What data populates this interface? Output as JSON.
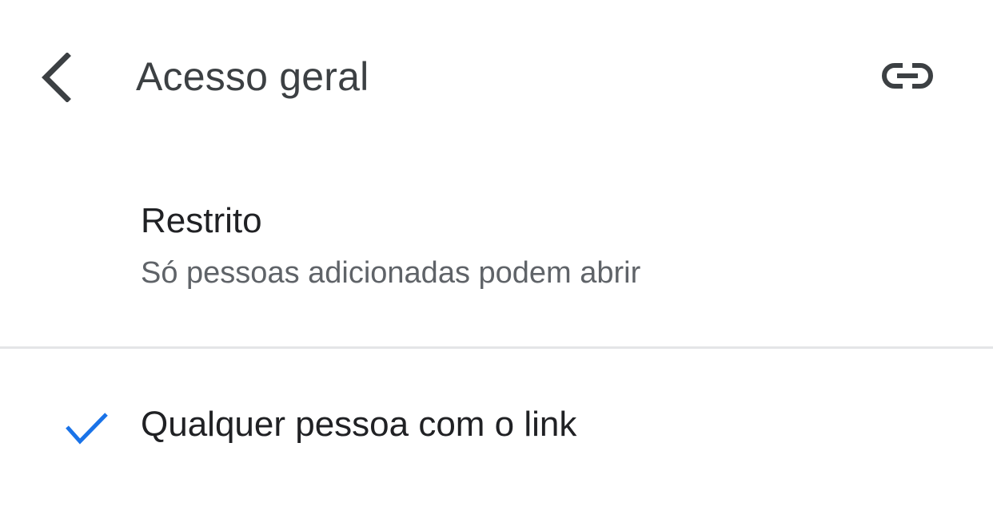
{
  "header": {
    "title": "Acesso geral",
    "back_icon": "chevron-left-icon",
    "link_icon": "link-icon"
  },
  "options": [
    {
      "title": "Restrito",
      "subtitle": "Só pessoas adicionadas podem abrir",
      "selected": false
    },
    {
      "title": "Qualquer pessoa com o link",
      "selected": true,
      "check_icon": "check-icon"
    }
  ],
  "colors": {
    "title_text": "#3c4043",
    "primary_text": "#202124",
    "secondary_text": "#5f6368",
    "icon": "#3c4043",
    "accent_check": "#1a73e8",
    "divider": "#e4e5e7",
    "background": "#ffffff"
  }
}
